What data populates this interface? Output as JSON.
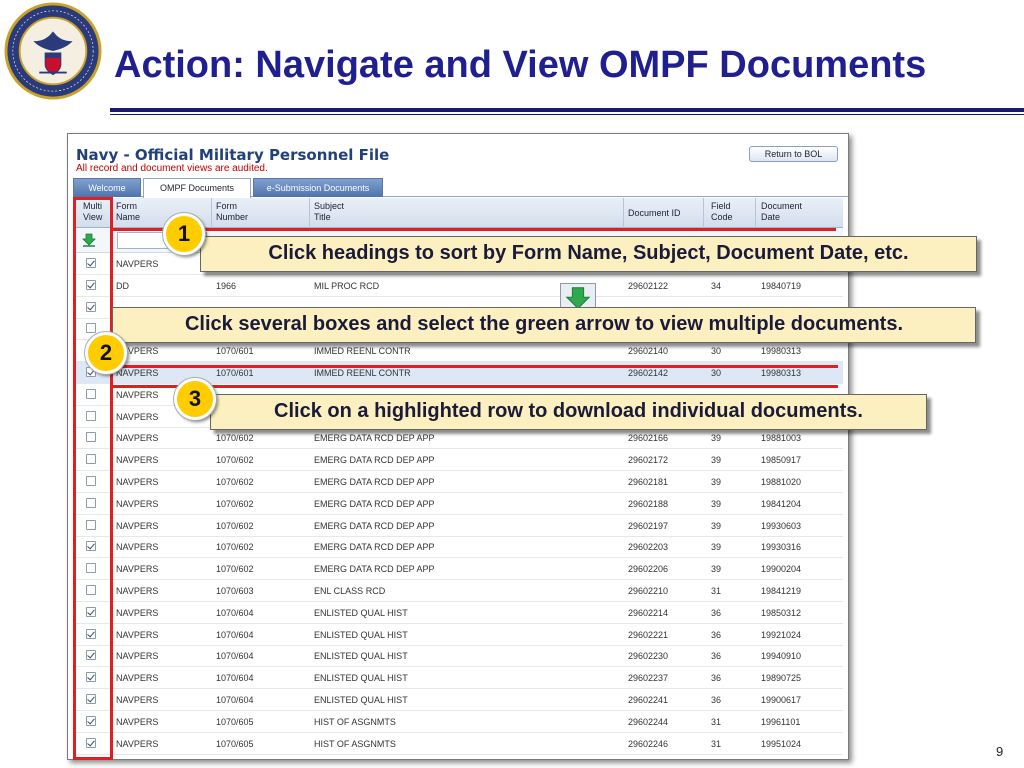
{
  "slide": {
    "title": "Action: Navigate and View OMPF Documents",
    "page_number": "9",
    "seal_lettering": "UNITED STATES NAVY · CHIEF OF NAVAL OPERATIONS"
  },
  "app": {
    "title": "Navy - Official Military Personnel File",
    "audit_notice": "All record and document views are audited.",
    "return_button": "Return to BOL",
    "tabs": [
      {
        "label": "Welcome",
        "active": false
      },
      {
        "label": "OMPF Documents",
        "active": true
      },
      {
        "label": "e-Submission Documents",
        "active": false
      }
    ]
  },
  "grid": {
    "headers": {
      "multi": [
        "Multi",
        "View"
      ],
      "form_name": [
        "Form",
        "Name"
      ],
      "form_number": [
        "Form",
        "Number"
      ],
      "subject": [
        "Subject",
        "Title"
      ],
      "document_id": [
        "Document ID"
      ],
      "field_code": [
        "Field",
        "Code"
      ],
      "document_date": [
        "Document",
        "Date"
      ]
    },
    "rows": [
      {
        "checked": true,
        "form_name": "NAVPERS",
        "form_number": "",
        "subject": "",
        "document_id": "",
        "field_code": "",
        "date": "",
        "highlight": false
      },
      {
        "checked": true,
        "form_name": "DD",
        "form_number": "1966",
        "subject": "MIL PROC RCD",
        "document_id": "29602122",
        "field_code": "34",
        "date": "19840719",
        "highlight": false
      },
      {
        "checked": true,
        "form_name": "",
        "form_number": "",
        "subject": "",
        "document_id": "",
        "field_code": "",
        "date": "",
        "highlight": false
      },
      {
        "checked": false,
        "form_name": "",
        "form_number": "",
        "subject": "",
        "document_id": "",
        "field_code": "",
        "date": "",
        "highlight": false
      },
      {
        "checked": false,
        "form_name": "NAVPERS",
        "form_number": "1070/601",
        "subject": "IMMED REENL CONTR",
        "document_id": "29602140",
        "field_code": "30",
        "date": "19980313",
        "highlight": false
      },
      {
        "checked": true,
        "form_name": "NAVPERS",
        "form_number": "1070/601",
        "subject": "IMMED REENL CONTR",
        "document_id": "29602142",
        "field_code": "30",
        "date": "19980313",
        "highlight": true
      },
      {
        "checked": false,
        "form_name": "NAVPERS",
        "form_number": "",
        "subject": "",
        "document_id": "",
        "field_code": "",
        "date": "",
        "highlight": false
      },
      {
        "checked": false,
        "form_name": "NAVPERS",
        "form_number": "",
        "subject": "",
        "document_id": "",
        "field_code": "",
        "date": "",
        "highlight": false
      },
      {
        "checked": false,
        "form_name": "NAVPERS",
        "form_number": "1070/602",
        "subject": "EMERG DATA RCD DEP APP",
        "document_id": "29602166",
        "field_code": "39",
        "date": "19881003",
        "highlight": false
      },
      {
        "checked": false,
        "form_name": "NAVPERS",
        "form_number": "1070/602",
        "subject": "EMERG DATA RCD DEP APP",
        "document_id": "29602172",
        "field_code": "39",
        "date": "19850917",
        "highlight": false
      },
      {
        "checked": false,
        "form_name": "NAVPERS",
        "form_number": "1070/602",
        "subject": "EMERG DATA RCD DEP APP",
        "document_id": "29602181",
        "field_code": "39",
        "date": "19881020",
        "highlight": false
      },
      {
        "checked": false,
        "form_name": "NAVPERS",
        "form_number": "1070/602",
        "subject": "EMERG DATA RCD DEP APP",
        "document_id": "29602188",
        "field_code": "39",
        "date": "19841204",
        "highlight": false
      },
      {
        "checked": false,
        "form_name": "NAVPERS",
        "form_number": "1070/602",
        "subject": "EMERG DATA RCD DEP APP",
        "document_id": "29602197",
        "field_code": "39",
        "date": "19930603",
        "highlight": false
      },
      {
        "checked": true,
        "form_name": "NAVPERS",
        "form_number": "1070/602",
        "subject": "EMERG DATA RCD DEP APP",
        "document_id": "29602203",
        "field_code": "39",
        "date": "19930316",
        "highlight": false
      },
      {
        "checked": false,
        "form_name": "NAVPERS",
        "form_number": "1070/602",
        "subject": "EMERG DATA RCD DEP APP",
        "document_id": "29602206",
        "field_code": "39",
        "date": "19900204",
        "highlight": false
      },
      {
        "checked": false,
        "form_name": "NAVPERS",
        "form_number": "1070/603",
        "subject": "ENL CLASS RCD",
        "document_id": "29602210",
        "field_code": "31",
        "date": "19841219",
        "highlight": false
      },
      {
        "checked": true,
        "form_name": "NAVPERS",
        "form_number": "1070/604",
        "subject": "ENLISTED QUAL HIST",
        "document_id": "29602214",
        "field_code": "36",
        "date": "19850312",
        "highlight": false
      },
      {
        "checked": true,
        "form_name": "NAVPERS",
        "form_number": "1070/604",
        "subject": "ENLISTED QUAL HIST",
        "document_id": "29602221",
        "field_code": "36",
        "date": "19921024",
        "highlight": false
      },
      {
        "checked": true,
        "form_name": "NAVPERS",
        "form_number": "1070/604",
        "subject": "ENLISTED QUAL HIST",
        "document_id": "29602230",
        "field_code": "36",
        "date": "19940910",
        "highlight": false
      },
      {
        "checked": true,
        "form_name": "NAVPERS",
        "form_number": "1070/604",
        "subject": "ENLISTED QUAL HIST",
        "document_id": "29602237",
        "field_code": "36",
        "date": "19890725",
        "highlight": false
      },
      {
        "checked": true,
        "form_name": "NAVPERS",
        "form_number": "1070/604",
        "subject": "ENLISTED QUAL HIST",
        "document_id": "29602241",
        "field_code": "36",
        "date": "19900617",
        "highlight": false
      },
      {
        "checked": true,
        "form_name": "NAVPERS",
        "form_number": "1070/605",
        "subject": "HIST OF ASGNMTS",
        "document_id": "29602244",
        "field_code": "31",
        "date": "19961101",
        "highlight": false
      },
      {
        "checked": true,
        "form_name": "NAVPERS",
        "form_number": "1070/605",
        "subject": "HIST OF ASGNMTS",
        "document_id": "29602246",
        "field_code": "31",
        "date": "19951024",
        "highlight": false
      }
    ]
  },
  "callouts": [
    {
      "number": "1",
      "text": "Click headings to sort by Form Name, Subject, Document Date, etc."
    },
    {
      "number": "2",
      "text": "Click several boxes and select the green arrow to view multiple documents."
    },
    {
      "number": "3",
      "text": "Click on a highlighted row to download individual documents."
    }
  ],
  "colors": {
    "title_blue": "#1f1f8f",
    "callout_red": "#e02020",
    "callout_fill": "#fdf0c0",
    "badge_yellow": "#ffcc00",
    "arrow_green": "#2fa84f"
  }
}
